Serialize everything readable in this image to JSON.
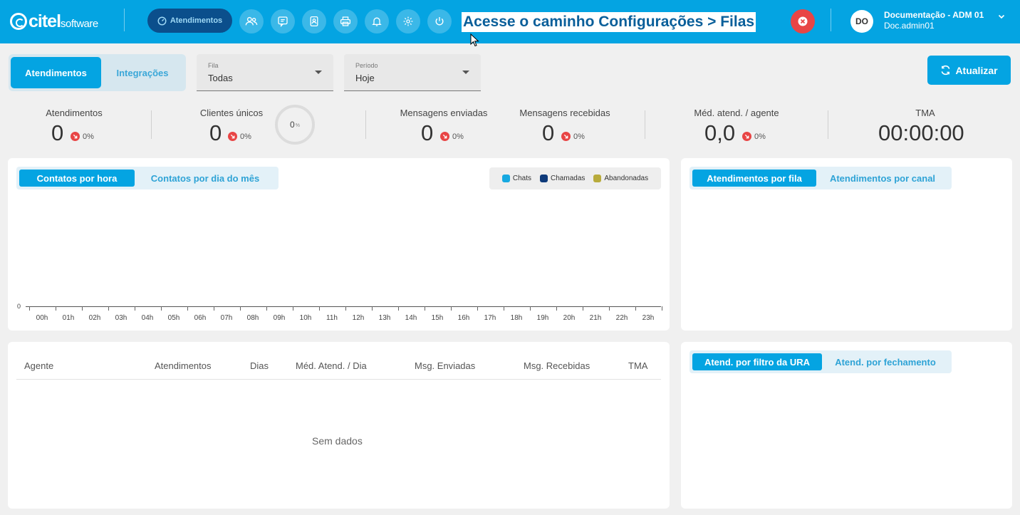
{
  "header": {
    "logo_text": "citel",
    "logo_sub": "software",
    "nav_active_label": "Atendimentos",
    "nav_icons": [
      "users-icon",
      "chat-icon",
      "contacts-icon",
      "printer-icon",
      "bell-icon",
      "gear-icon",
      "power-icon"
    ],
    "overlay_title": "Acesse o caminho Configurações > Filas",
    "user": {
      "initials": "DO",
      "name": "Documentação - ADM 01",
      "login": "Doc.admin01"
    }
  },
  "filters": {
    "segment": {
      "active": "Atendimentos",
      "inactive": "Integrações"
    },
    "fila": {
      "label": "Fila",
      "value": "Todas"
    },
    "periodo": {
      "label": "Período",
      "value": "Hoje"
    },
    "refresh_label": "Atualizar"
  },
  "stats": {
    "atendimentos": {
      "label": "Atendimentos",
      "value": "0",
      "delta": "0%"
    },
    "clientes": {
      "label": "Clientes únicos",
      "value": "0",
      "delta": "0%",
      "ring_value": "0",
      "ring_unit": "%"
    },
    "enviadas": {
      "label": "Mensagens enviadas",
      "value": "0",
      "delta": "0%"
    },
    "recebidas": {
      "label": "Mensagens recebidas",
      "value": "0",
      "delta": "0%"
    },
    "media": {
      "label": "Méd. atend. / agente",
      "value": "0,0",
      "delta": "0%"
    },
    "tma": {
      "label": "TMA",
      "value": "00:00:00"
    }
  },
  "contacts_panel": {
    "tabs": [
      "Contatos por hora",
      "Contatos por dia do mês"
    ],
    "legend": [
      {
        "name": "Chats",
        "color": "#17a9e1"
      },
      {
        "name": "Chamadas",
        "color": "#0e3a7a"
      },
      {
        "name": "Abandonadas",
        "color": "#b8ab3c"
      }
    ]
  },
  "chart_data": {
    "type": "bar",
    "categories": [
      "00h",
      "01h",
      "02h",
      "03h",
      "04h",
      "05h",
      "06h",
      "07h",
      "08h",
      "09h",
      "10h",
      "11h",
      "12h",
      "13h",
      "14h",
      "15h",
      "16h",
      "17h",
      "18h",
      "19h",
      "20h",
      "21h",
      "22h",
      "23h"
    ],
    "series": [
      {
        "name": "Chats",
        "values": [
          0,
          0,
          0,
          0,
          0,
          0,
          0,
          0,
          0,
          0,
          0,
          0,
          0,
          0,
          0,
          0,
          0,
          0,
          0,
          0,
          0,
          0,
          0,
          0
        ]
      },
      {
        "name": "Chamadas",
        "values": [
          0,
          0,
          0,
          0,
          0,
          0,
          0,
          0,
          0,
          0,
          0,
          0,
          0,
          0,
          0,
          0,
          0,
          0,
          0,
          0,
          0,
          0,
          0,
          0
        ]
      },
      {
        "name": "Abandonadas",
        "values": [
          0,
          0,
          0,
          0,
          0,
          0,
          0,
          0,
          0,
          0,
          0,
          0,
          0,
          0,
          0,
          0,
          0,
          0,
          0,
          0,
          0,
          0,
          0,
          0
        ]
      }
    ],
    "y_tick_labels": [
      "0"
    ],
    "legend_position": "top-right",
    "grid": false
  },
  "fila_panel": {
    "tabs": [
      "Atendimentos por fila",
      "Atendimentos por canal"
    ]
  },
  "agent_table": {
    "columns": [
      "Agente",
      "Atendimentos",
      "Dias",
      "Méd. Atend. / Dia",
      "Msg. Enviadas",
      "Msg. Recebidas",
      "TMA"
    ],
    "empty_text": "Sem dados"
  },
  "ura_panel": {
    "tabs": [
      "Atend. por filtro da URA",
      "Atend. por fechamento"
    ]
  }
}
